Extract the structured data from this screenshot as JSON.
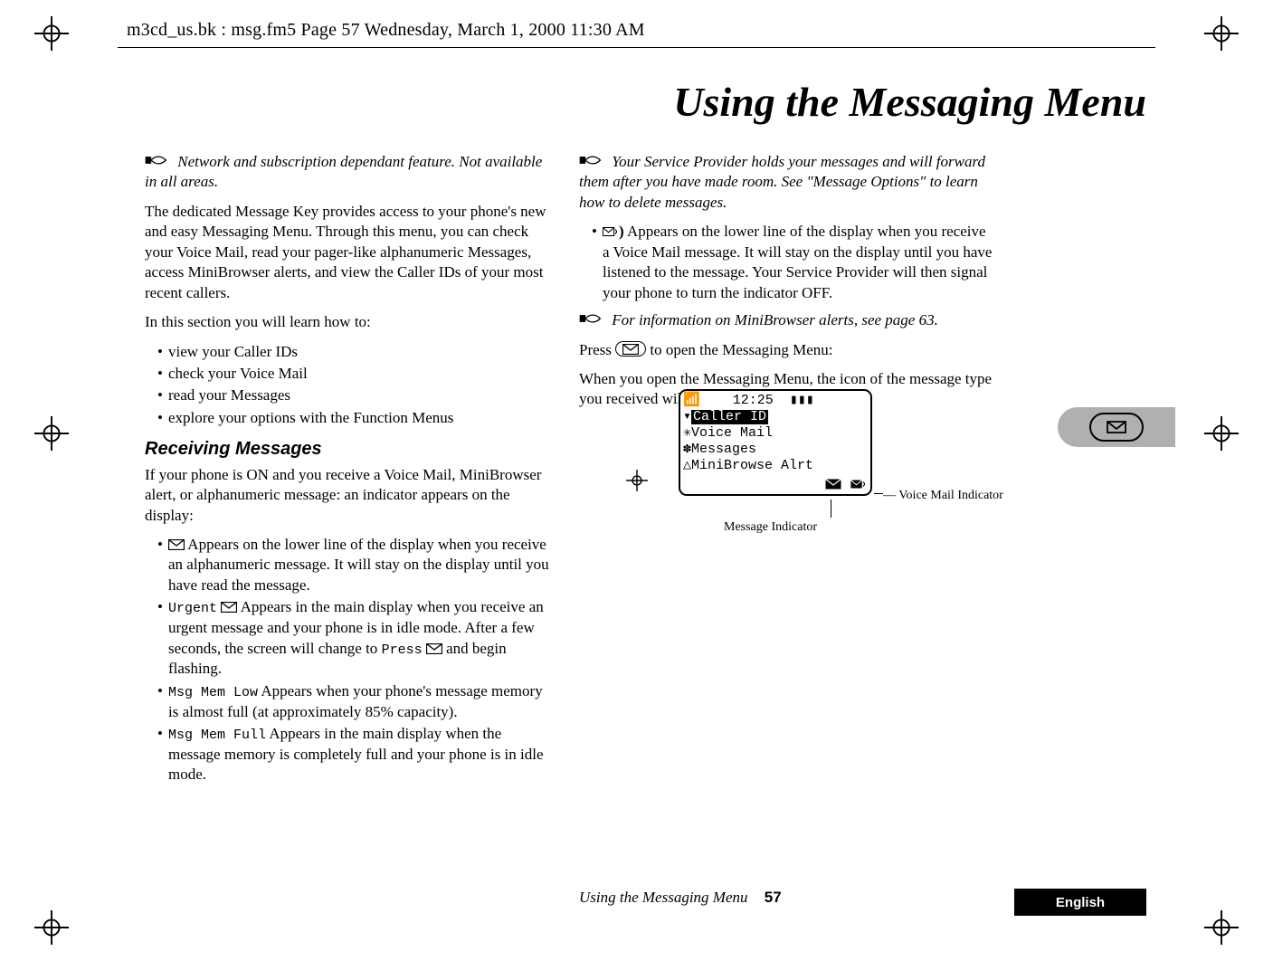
{
  "header": {
    "running_head": "m3cd_us.bk : msg.fm5  Page 57  Wednesday, March 1, 2000  11:30 AM"
  },
  "title": "Using the Messaging Menu",
  "left": {
    "note1": "Network and subscription dependant feature. Not available in all areas.",
    "p1": "The dedicated Message Key provides access to your phone's new and easy Messaging Menu. Through this menu, you can check your Voice Mail, read your pager-like alphanumeric Messages, access MiniBrowser alerts, and view the Caller IDs of your most recent callers.",
    "p2": "In this section you will learn how to:",
    "bullets_learn": [
      "view your Caller IDs",
      "check your Voice Mail",
      "read your Messages",
      "explore your options with the Function Menus"
    ],
    "sect": "Receiving Messages",
    "p3": "If your phone is ON and you receive a Voice Mail, MiniBrowser alert, or alphanumeric message: an indicator appears on the display:",
    "rx": {
      "b1": " Appears on the lower line of the display when you receive an alphanumeric message. It will stay on the display until you have read the message.",
      "b2_pre": "Urgent",
      "b2": " Appears in the main display when you receive an urgent message and your phone is in idle mode. After a few seconds, the screen will change to ",
      "b2_mid": "Press",
      "b2_end": " and begin flashing.",
      "b3_pre": "Msg Mem Low",
      "b3": " Appears when your phone's message memory is almost full (at approximately 85% capacity).",
      "b4_pre": "Msg Mem Full",
      "b4": " Appears in the main display when the message memory is completely full and your phone is in idle mode."
    }
  },
  "right": {
    "note1": "Your Service Provider holds your messages and will forward them after you have made room. See \"Message Options\" to learn how to delete messages.",
    "b_vm": " Appears on the lower line of the display when you receive a Voice Mail message. It will stay on the display until you have listened to the message. Your Service Provider will then signal your phone to turn the indicator OFF.",
    "note2": "For information on MiniBrowser alerts, see page 63.",
    "p_press": "Press ",
    "p_press_end": " to open the Messaging Menu:",
    "p_flash": "When you open the Messaging Menu, the icon of the message type you received will be flashing."
  },
  "lcd": {
    "clock": "12:25",
    "line_caller": "Caller ID",
    "line_vm": "Voice Mail",
    "line_msg": "Messages",
    "line_mb": "MiniBrowse Alrt",
    "cap_vm": "Voice Mail Indicator",
    "cap_msg": "Message Indicator"
  },
  "footer": {
    "section": "Using the Messaging Menu",
    "page": "57",
    "lang": "English"
  }
}
